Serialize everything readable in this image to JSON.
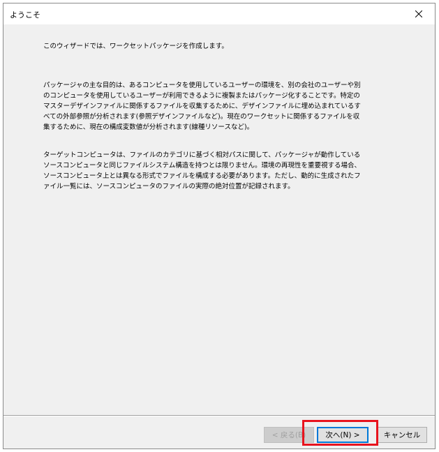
{
  "window": {
    "title": "ようこそ"
  },
  "content": {
    "intro": "このウィザードでは、ワークセットパッケージを作成します。",
    "purpose": "パッケージャの主な目的は、あるコンピュータを使用しているユーザーの環境を、別の会社のユーザーや別のコンピュータを使用しているユーザーが利用できるように複製またはパッケージ化することです。特定のマスターデザインファイルに関係するファイルを収集するために、デザインファイルに埋め込まれているすべての外部参照が分析されます(参照デザインファイルなど)。現在のワークセットに関係するファイルを収集するために、現在の構成変数値が分析されます(線種リソースなど)。",
    "target": "ターゲットコンピュータは、ファイルのカテゴリに基づく相対パスに関して、パッケージャが動作しているソースコンピュータと同じファイルシステム構造を持つとは限りません。環境の再現性を重要視する場合、ソースコンピュータ上とは異なる形式でファイルを構成する必要があります。ただし、動的に生成されたファイル一覧には、ソースコンピュータのファイルの実際の絶対位置が記録されます。"
  },
  "buttons": {
    "back": "< 戻る(B)",
    "next": "次へ(N) >",
    "cancel": "キャンセル"
  },
  "colors": {
    "highlight": "#e8131d",
    "focus": "#0078d7",
    "window_bg": "#f0f0f0"
  },
  "icons": {
    "close": "close-icon"
  }
}
